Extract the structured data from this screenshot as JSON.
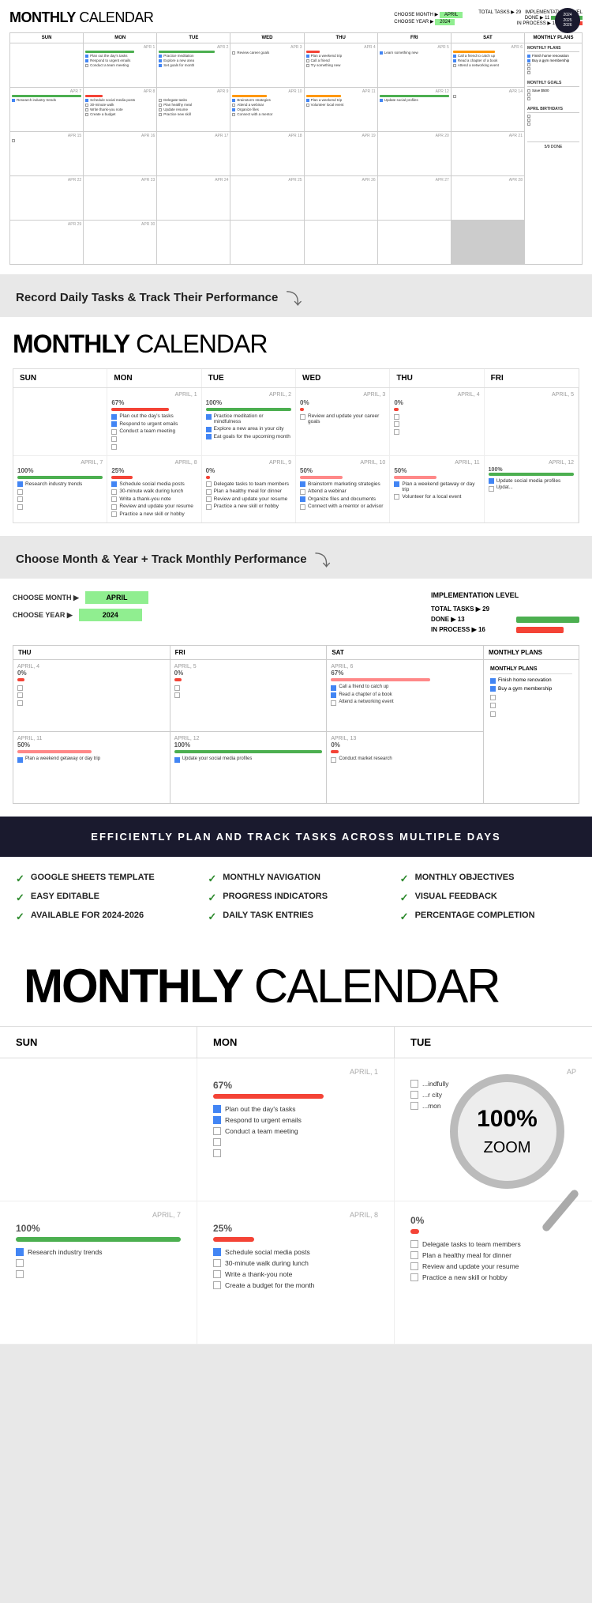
{
  "badge": {
    "years": [
      "2024",
      "2025",
      "2026"
    ]
  },
  "caption1": {
    "text": "Record Daily Tasks & Track Their Performance"
  },
  "caption2": {
    "text": "Choose Month & Year + Track Monthly Performance"
  },
  "banner": {
    "text": "EFFICIENTLY PLAN AND TRACK TASKS ACROSS MULTIPLE DAYS"
  },
  "features": [
    {
      "id": "google-sheets",
      "text": "GOOGLE SHEETS TEMPLATE"
    },
    {
      "id": "monthly-nav",
      "text": "MONTHLY NAVIGATION"
    },
    {
      "id": "monthly-obj",
      "text": "MONTHLY OBJECTIVES"
    },
    {
      "id": "easy-editable",
      "text": "EASY EDITABLE"
    },
    {
      "id": "progress-indicators",
      "text": "PROGRESS INDICATORS"
    },
    {
      "id": "visual-feedback",
      "text": "VISUAL FEEDBACK"
    },
    {
      "id": "available",
      "text": "AVAILABLE FOR 2024-2026"
    },
    {
      "id": "daily-tasks",
      "text": "DAILY TASK ENTRIES"
    },
    {
      "id": "pct-completion",
      "text": "PERCENTAGE COMPLETION"
    }
  ],
  "calendar": {
    "title_bold": "MONTHLY",
    "title_light": " CALENDAR",
    "choose_month_label": "CHOOSE MONTH ▶",
    "choose_year_label": "CHOOSE YEAR ▶",
    "month_value": "APRIL",
    "year_value": "2024",
    "total_tasks_label": "TOTAL TASKS ▶",
    "done_label": "DONE ▶",
    "inprocess_label": "IN PROCESS ▶",
    "total_tasks_num": "29",
    "done_num": "13",
    "inprocess_num": "16",
    "impl_label": "IMPLEMENTATION LEVEL",
    "days": [
      "SUN",
      "MON",
      "TUE",
      "WED",
      "THU",
      "FRI",
      "SAT"
    ],
    "monthly_plans_title": "MONTHLY PLANS",
    "monthly_plans": [
      {
        "text": "Finish home renovation",
        "checked": true
      },
      {
        "text": "Buy a gym membership",
        "checked": true
      },
      {
        "text": "",
        "checked": false
      },
      {
        "text": "",
        "checked": false
      },
      {
        "text": "",
        "checked": false
      }
    ],
    "monthly_goals_title": "MONTHLY GOALS",
    "april_bday_title": "APRIL BIRTHDAYS"
  },
  "zoom_demo": {
    "title_bold": "MONTHLY",
    "title_light": " CALENDAR",
    "zoom_label": "100%\nZOOM",
    "columns": [
      "SUN",
      "MON",
      "TUE"
    ],
    "week1": {
      "sun": {
        "date": "",
        "pct": "",
        "pct_color": ""
      },
      "mon": {
        "date": "APRIL, 1",
        "pct": "67%",
        "pct_color": "#f44336",
        "tasks": [
          {
            "text": "Plan out the day's tasks",
            "checked": true
          },
          {
            "text": "Respond to urgent emails",
            "checked": true
          },
          {
            "text": "Conduct a team meeting",
            "checked": true
          },
          {
            "text": "",
            "checked": false
          },
          {
            "text": "",
            "checked": false
          }
        ]
      },
      "tue": {
        "date": "AP",
        "pct": "",
        "tasks": [
          {
            "text": "indfully",
            "checked": false
          },
          {
            "text": "r city",
            "checked": false
          },
          {
            "text": "mon",
            "checked": false
          }
        ]
      }
    },
    "week2": {
      "sun": {
        "date": "APRIL, 7",
        "pct": "100%",
        "pct_color": "#4CAF50",
        "tasks": [
          {
            "text": "Research industry trends",
            "checked": true
          },
          {
            "text": "",
            "checked": false
          },
          {
            "text": "",
            "checked": false
          }
        ]
      },
      "mon": {
        "date": "APRIL, 8",
        "pct": "25%",
        "pct_color": "#f44336",
        "tasks": [
          {
            "text": "Schedule social media posts",
            "checked": true
          },
          {
            "text": "30-minute walk during lunch",
            "checked": false
          },
          {
            "text": "Write a thank-you note",
            "checked": false
          },
          {
            "text": "Create a budget for the month",
            "checked": false
          }
        ]
      },
      "tue": {
        "date": "0%",
        "pct_color": "#f44336",
        "tasks": [
          {
            "text": "Delegate tasks to team members",
            "checked": false
          },
          {
            "text": "Plan a healthy meal for dinner",
            "checked": false
          },
          {
            "text": "Review and update your resume",
            "checked": false
          },
          {
            "text": "Practice a new skill or hobby",
            "checked": false
          }
        ]
      }
    }
  }
}
